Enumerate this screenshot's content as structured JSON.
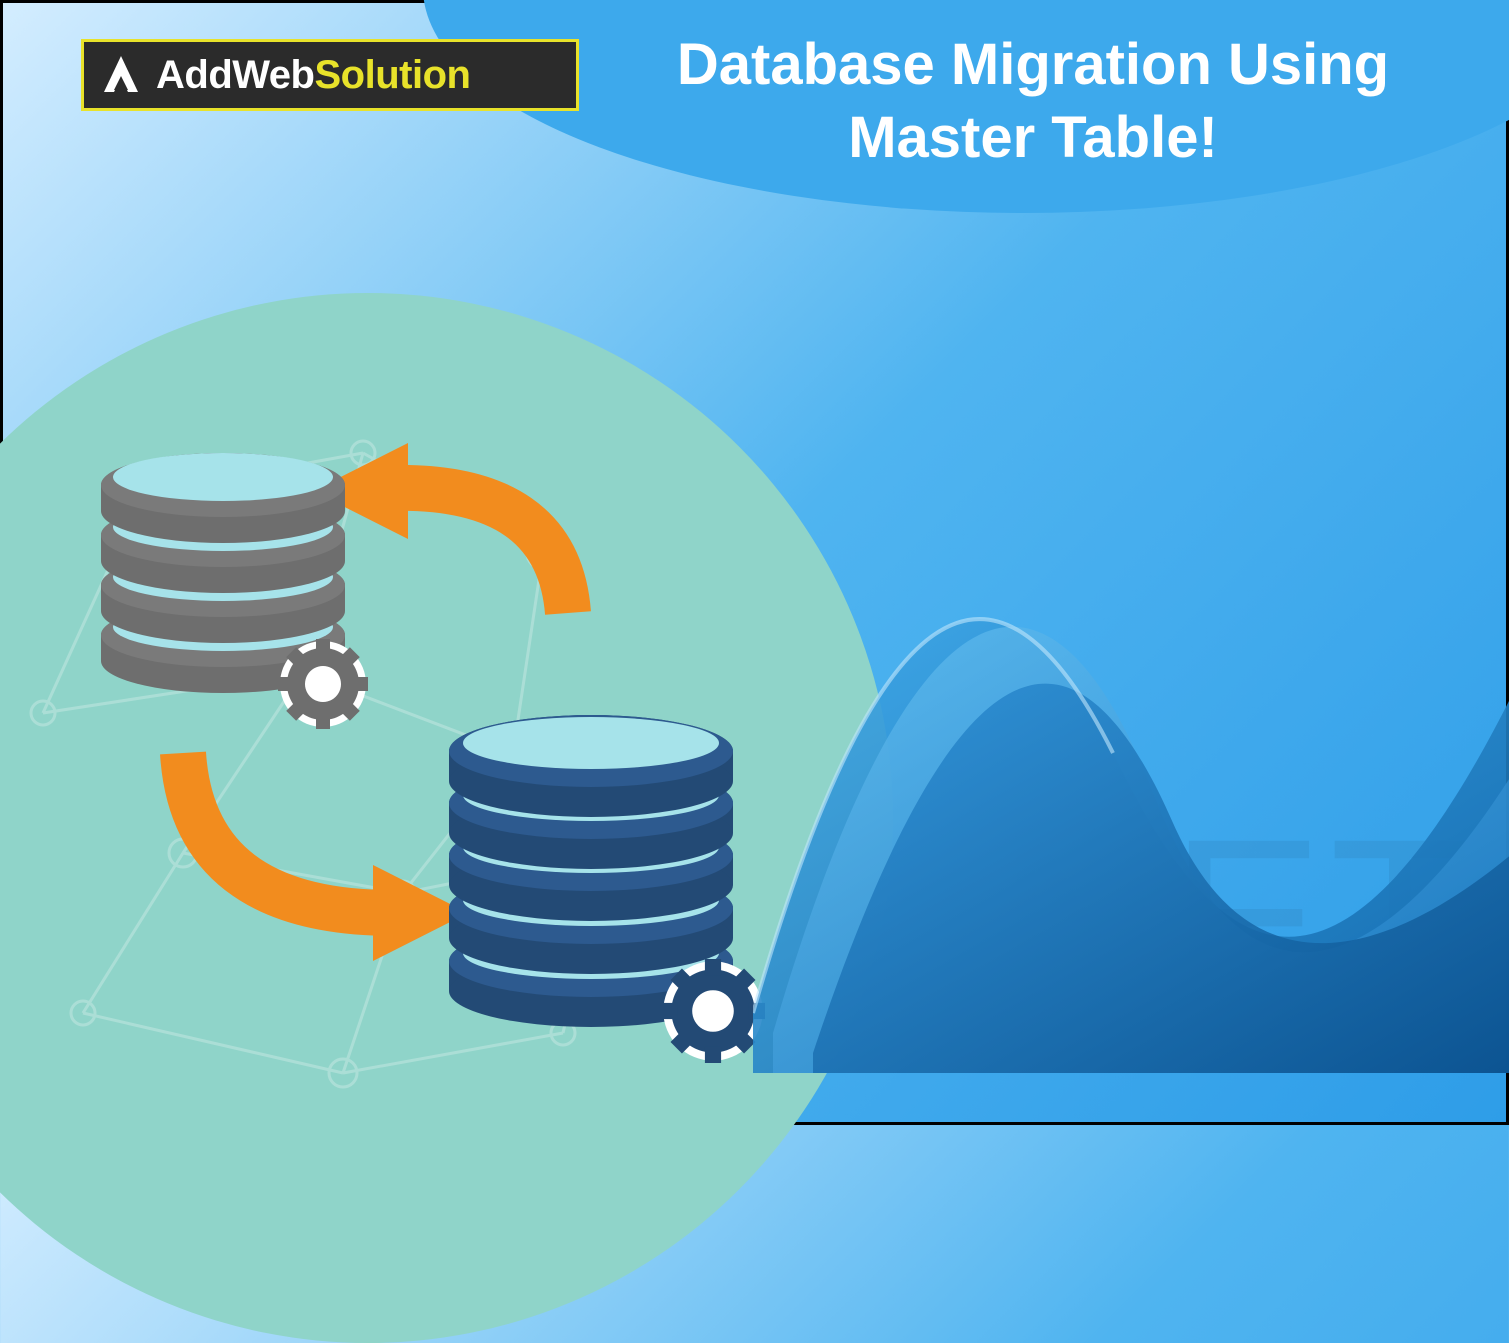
{
  "logo": {
    "word1": "AddWeb",
    "word2": "Solution"
  },
  "title": {
    "line1": "Database Migration Using",
    "line2": "Master Table!"
  },
  "watermark": "NET",
  "colors": {
    "accent_orange": "#f28c1e",
    "db_gray": "#6e6e6e",
    "db_blue": "#234a75",
    "teal": "#8fd4c9",
    "gradient_light": "#d4edff",
    "gradient_dark": "#2e9de8",
    "logo_yellow": "#e8e22a"
  },
  "icons": {
    "logo_mark": "triangle-logo-icon",
    "db1": "database-gray-icon",
    "db2": "database-blue-icon",
    "gear": "gear-icon",
    "arrow_up": "curved-arrow-up-icon",
    "arrow_down": "curved-arrow-down-icon",
    "wave": "dotnet-wave-icon"
  }
}
